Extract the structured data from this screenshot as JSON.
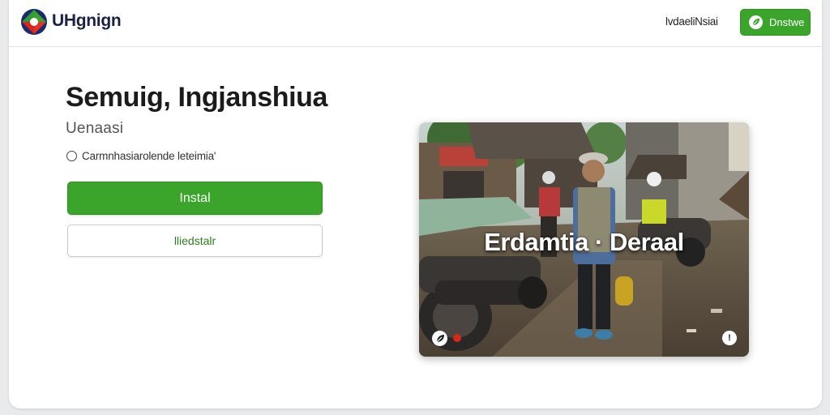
{
  "header": {
    "brand_name": "UHgnign",
    "logo_icon": "brand-logo-icon",
    "nav_link_label": "lvdaeliNsiai",
    "nav_button_label": "Dnstwe",
    "nav_button_icon": "leaf-icon"
  },
  "main": {
    "heading": "Semuig, Ingjanshiua",
    "subheading": "Uenaasi",
    "option_label": "Carmnhasiarolende leteimia'",
    "primary_button_label": "Instal",
    "secondary_button_label": "lliedstalr"
  },
  "media": {
    "caption": "Erdamtia · Deraal",
    "left_icon": "leaf-icon",
    "right_icon": "info-icon",
    "right_icon_glyph": "!"
  },
  "colors": {
    "accent_green": "#3aa52a",
    "record_red": "#d8261d"
  }
}
